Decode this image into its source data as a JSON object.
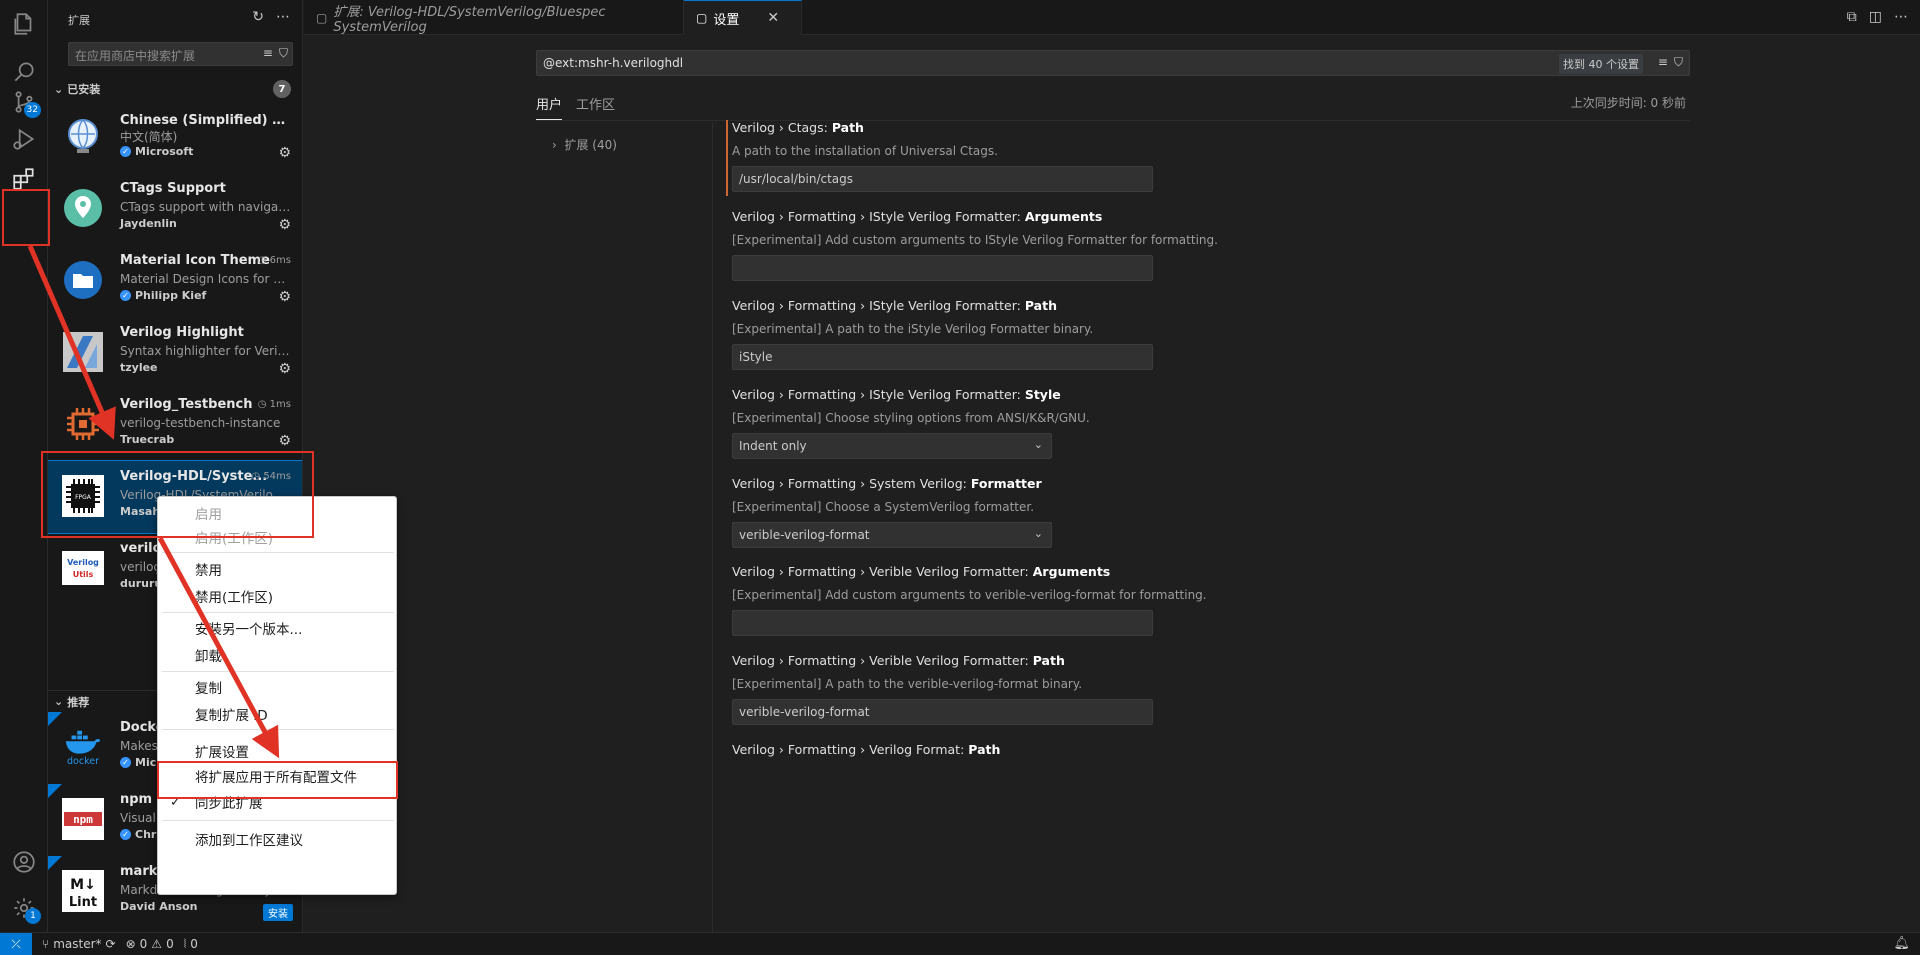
{
  "sidebar": {
    "title": "扩展",
    "search_placeholder": "在应用商店中搜索扩展",
    "installed_label": "已安装",
    "installed_count": "7",
    "recommended_label": "推荐",
    "installed": [
      {
        "name": "Chinese (Simplified) (简体...",
        "desc": "中文(简体)",
        "publisher": "Microsoft",
        "verified": true,
        "timer": ""
      },
      {
        "name": "CTags Support",
        "desc": "CTags support with navigati...",
        "publisher": "Jaydenlin",
        "verified": false,
        "timer": ""
      },
      {
        "name": "Material Icon Theme",
        "desc": "Material Design Icons for Vis...",
        "publisher": "Philipp Kief",
        "verified": true,
        "timer": "6ms"
      },
      {
        "name": "Verilog Highlight",
        "desc": "Syntax highlighter for Verilog",
        "publisher": "tzylee",
        "verified": false,
        "timer": ""
      },
      {
        "name": "Verilog_Testbench",
        "desc": "verilog-testbench-instance",
        "publisher": "Truecrab",
        "verified": false,
        "timer": "1ms"
      },
      {
        "name": "Verilog-HDL/Syste...",
        "desc": "Verilog-HDL/SystemVerilog/...",
        "publisher": "Masahi",
        "verified": false,
        "timer": "54ms"
      },
      {
        "name": "veriloç",
        "desc": "veriloç",
        "publisher": "dururu",
        "verified": false,
        "timer": ""
      }
    ],
    "recommended": [
      {
        "name": "Docke",
        "desc": "Makes",
        "publisher": "Mic",
        "verified": true
      },
      {
        "name": "npm In",
        "desc": "Visual",
        "publisher": "Chr",
        "verified": true
      },
      {
        "name": "markd",
        "desc": "Markdown linting and style",
        "publisher": "David Anson",
        "verified": false,
        "install": "安装"
      }
    ],
    "fpga_chip_label": "FPGA",
    "verilog_utils_logo": "Verilog Utils",
    "docker_logo": "docker",
    "npm_logo": "npm",
    "mdlint_logo": "M↓ Lint"
  },
  "activity": {
    "source_control_badge": "32",
    "settings_badge": "1"
  },
  "tabs": [
    {
      "label": "扩展: Verilog-HDL/SystemVerilog/Bluespec SystemVerilog",
      "active": false
    },
    {
      "label": "设置",
      "active": true
    }
  ],
  "settings": {
    "search_value": "@ext:mshr-h.veriloghdl",
    "found_label": "找到 40 个设置",
    "tab_user": "用户",
    "tab_workspace": "工作区",
    "sync_text": "上次同步时间: 0 秒前",
    "toc_item": "扩展 (40)",
    "items": [
      {
        "prefix": "Verilog › Ctags: ",
        "key": "Path",
        "desc": "A path to the installation of Universal Ctags.",
        "type": "input",
        "value": "/usr/local/bin/ctags"
      },
      {
        "prefix": "Verilog › Formatting › IStyle Verilog Formatter: ",
        "key": "Arguments",
        "desc": "[Experimental] Add custom arguments to IStyle Verilog Formatter for formatting.",
        "type": "input",
        "value": ""
      },
      {
        "prefix": "Verilog › Formatting › IStyle Verilog Formatter: ",
        "key": "Path",
        "desc": "[Experimental] A path to the iStyle Verilog Formatter binary.",
        "type": "input",
        "value": "iStyle"
      },
      {
        "prefix": "Verilog › Formatting › IStyle Verilog Formatter: ",
        "key": "Style",
        "desc": "[Experimental] Choose styling options from ANSI/K&R/GNU.",
        "type": "select",
        "value": "Indent only"
      },
      {
        "prefix": "Verilog › Formatting › System Verilog: ",
        "key": "Formatter",
        "desc": "[Experimental] Choose a SystemVerilog formatter.",
        "type": "select",
        "value": "verible-verilog-format"
      },
      {
        "prefix": "Verilog › Formatting › Verible Verilog Formatter: ",
        "key": "Arguments",
        "desc": "[Experimental] Add custom arguments to verible-verilog-format for formatting.",
        "type": "input",
        "value": ""
      },
      {
        "prefix": "Verilog › Formatting › Verible Verilog Formatter: ",
        "key": "Path",
        "desc": "[Experimental] A path to the verible-verilog-format binary.",
        "type": "input",
        "value": "verible-verilog-format"
      },
      {
        "prefix": "Verilog › Formatting › Verilog Format: ",
        "key": "Path",
        "desc": "",
        "type": "none",
        "value": ""
      }
    ]
  },
  "context_menu": {
    "items": [
      {
        "label": "启用",
        "disabled": true
      },
      {
        "label": "启用(工作区)",
        "disabled": true
      },
      {
        "label": "禁用",
        "disabled": false
      },
      {
        "label": "禁用(工作区)",
        "disabled": false
      },
      {
        "label": "安装另一个版本...",
        "disabled": false
      },
      {
        "label": "卸载",
        "disabled": false
      },
      {
        "label": "复制",
        "disabled": false
      },
      {
        "label": "复制扩展 ID",
        "disabled": false
      },
      {
        "label": "扩展设置",
        "disabled": false
      },
      {
        "label": "将扩展应用于所有配置文件",
        "disabled": false
      },
      {
        "label": "同步此扩展",
        "disabled": false,
        "checked": true
      },
      {
        "label": "添加到工作区建议",
        "disabled": false
      }
    ]
  },
  "status": {
    "branch": "master*",
    "errors": "0",
    "warnings": "0",
    "ports": "0"
  },
  "colors": {
    "accent": "#0078d4",
    "annotation_red": "#e03326"
  }
}
